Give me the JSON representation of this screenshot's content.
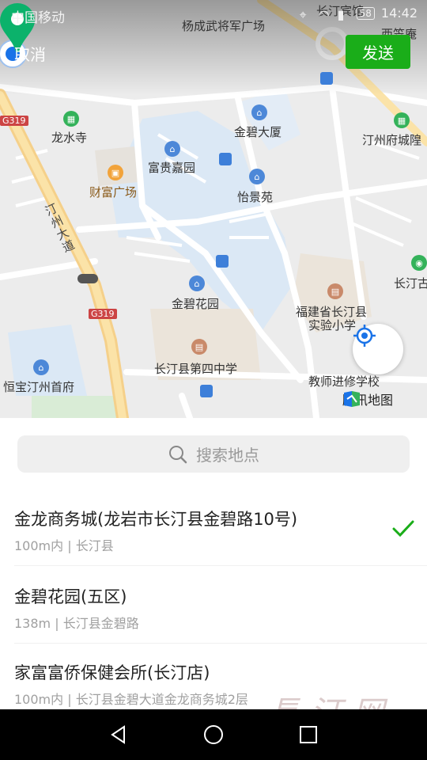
{
  "status_bar": {
    "carrier": "中国移动",
    "time": "14:42",
    "battery": "58"
  },
  "header": {
    "cancel_label": "取消",
    "send_label": "发送"
  },
  "map": {
    "labels": {
      "yangchengwu": "杨成武将军广场",
      "changting_hotel": "长汀宾馆",
      "xizhuan": "西笠庵",
      "longshuisi": "龙水寺",
      "jinbi_dasha": "金碧大厦",
      "tingzhou_fucheng": "汀州府城隍",
      "fuguijiayuan": "富贵嘉园",
      "caifu_guangchang": "财富广场",
      "yijingyuan": "怡景苑",
      "tingzhou_dadao": "汀州大道",
      "jinbihuayuan": "金碧花园",
      "fujian_school_1": "福建省长汀县",
      "fujian_school_2": "实验小学",
      "changting_gu": "长汀古",
      "no4_school": "长汀县第四中学",
      "hengbao": "恒宝汀州首府",
      "teacher_school": "教师进修学校",
      "road_g319_a": "G319",
      "road_g319_b": "G319"
    },
    "brand": "腾讯地图"
  },
  "search": {
    "placeholder": "搜索地点"
  },
  "results": [
    {
      "title": "金龙商务城(龙岩市长汀县金碧路10号)",
      "subtitle": "100m内 | 长汀县",
      "selected": true
    },
    {
      "title": "金碧花园(五区)",
      "subtitle": "138m | 长汀县金碧路",
      "selected": false
    },
    {
      "title": "家富富侨保健会所(长汀店)",
      "subtitle": "100m内 | 长汀县金碧大道金龙商务城2层",
      "selected": false
    }
  ],
  "watermark": "長汀网",
  "colors": {
    "accent_green": "#1aad19",
    "pin_green": "#0bb26b",
    "location_blue": "#1a73e8"
  }
}
